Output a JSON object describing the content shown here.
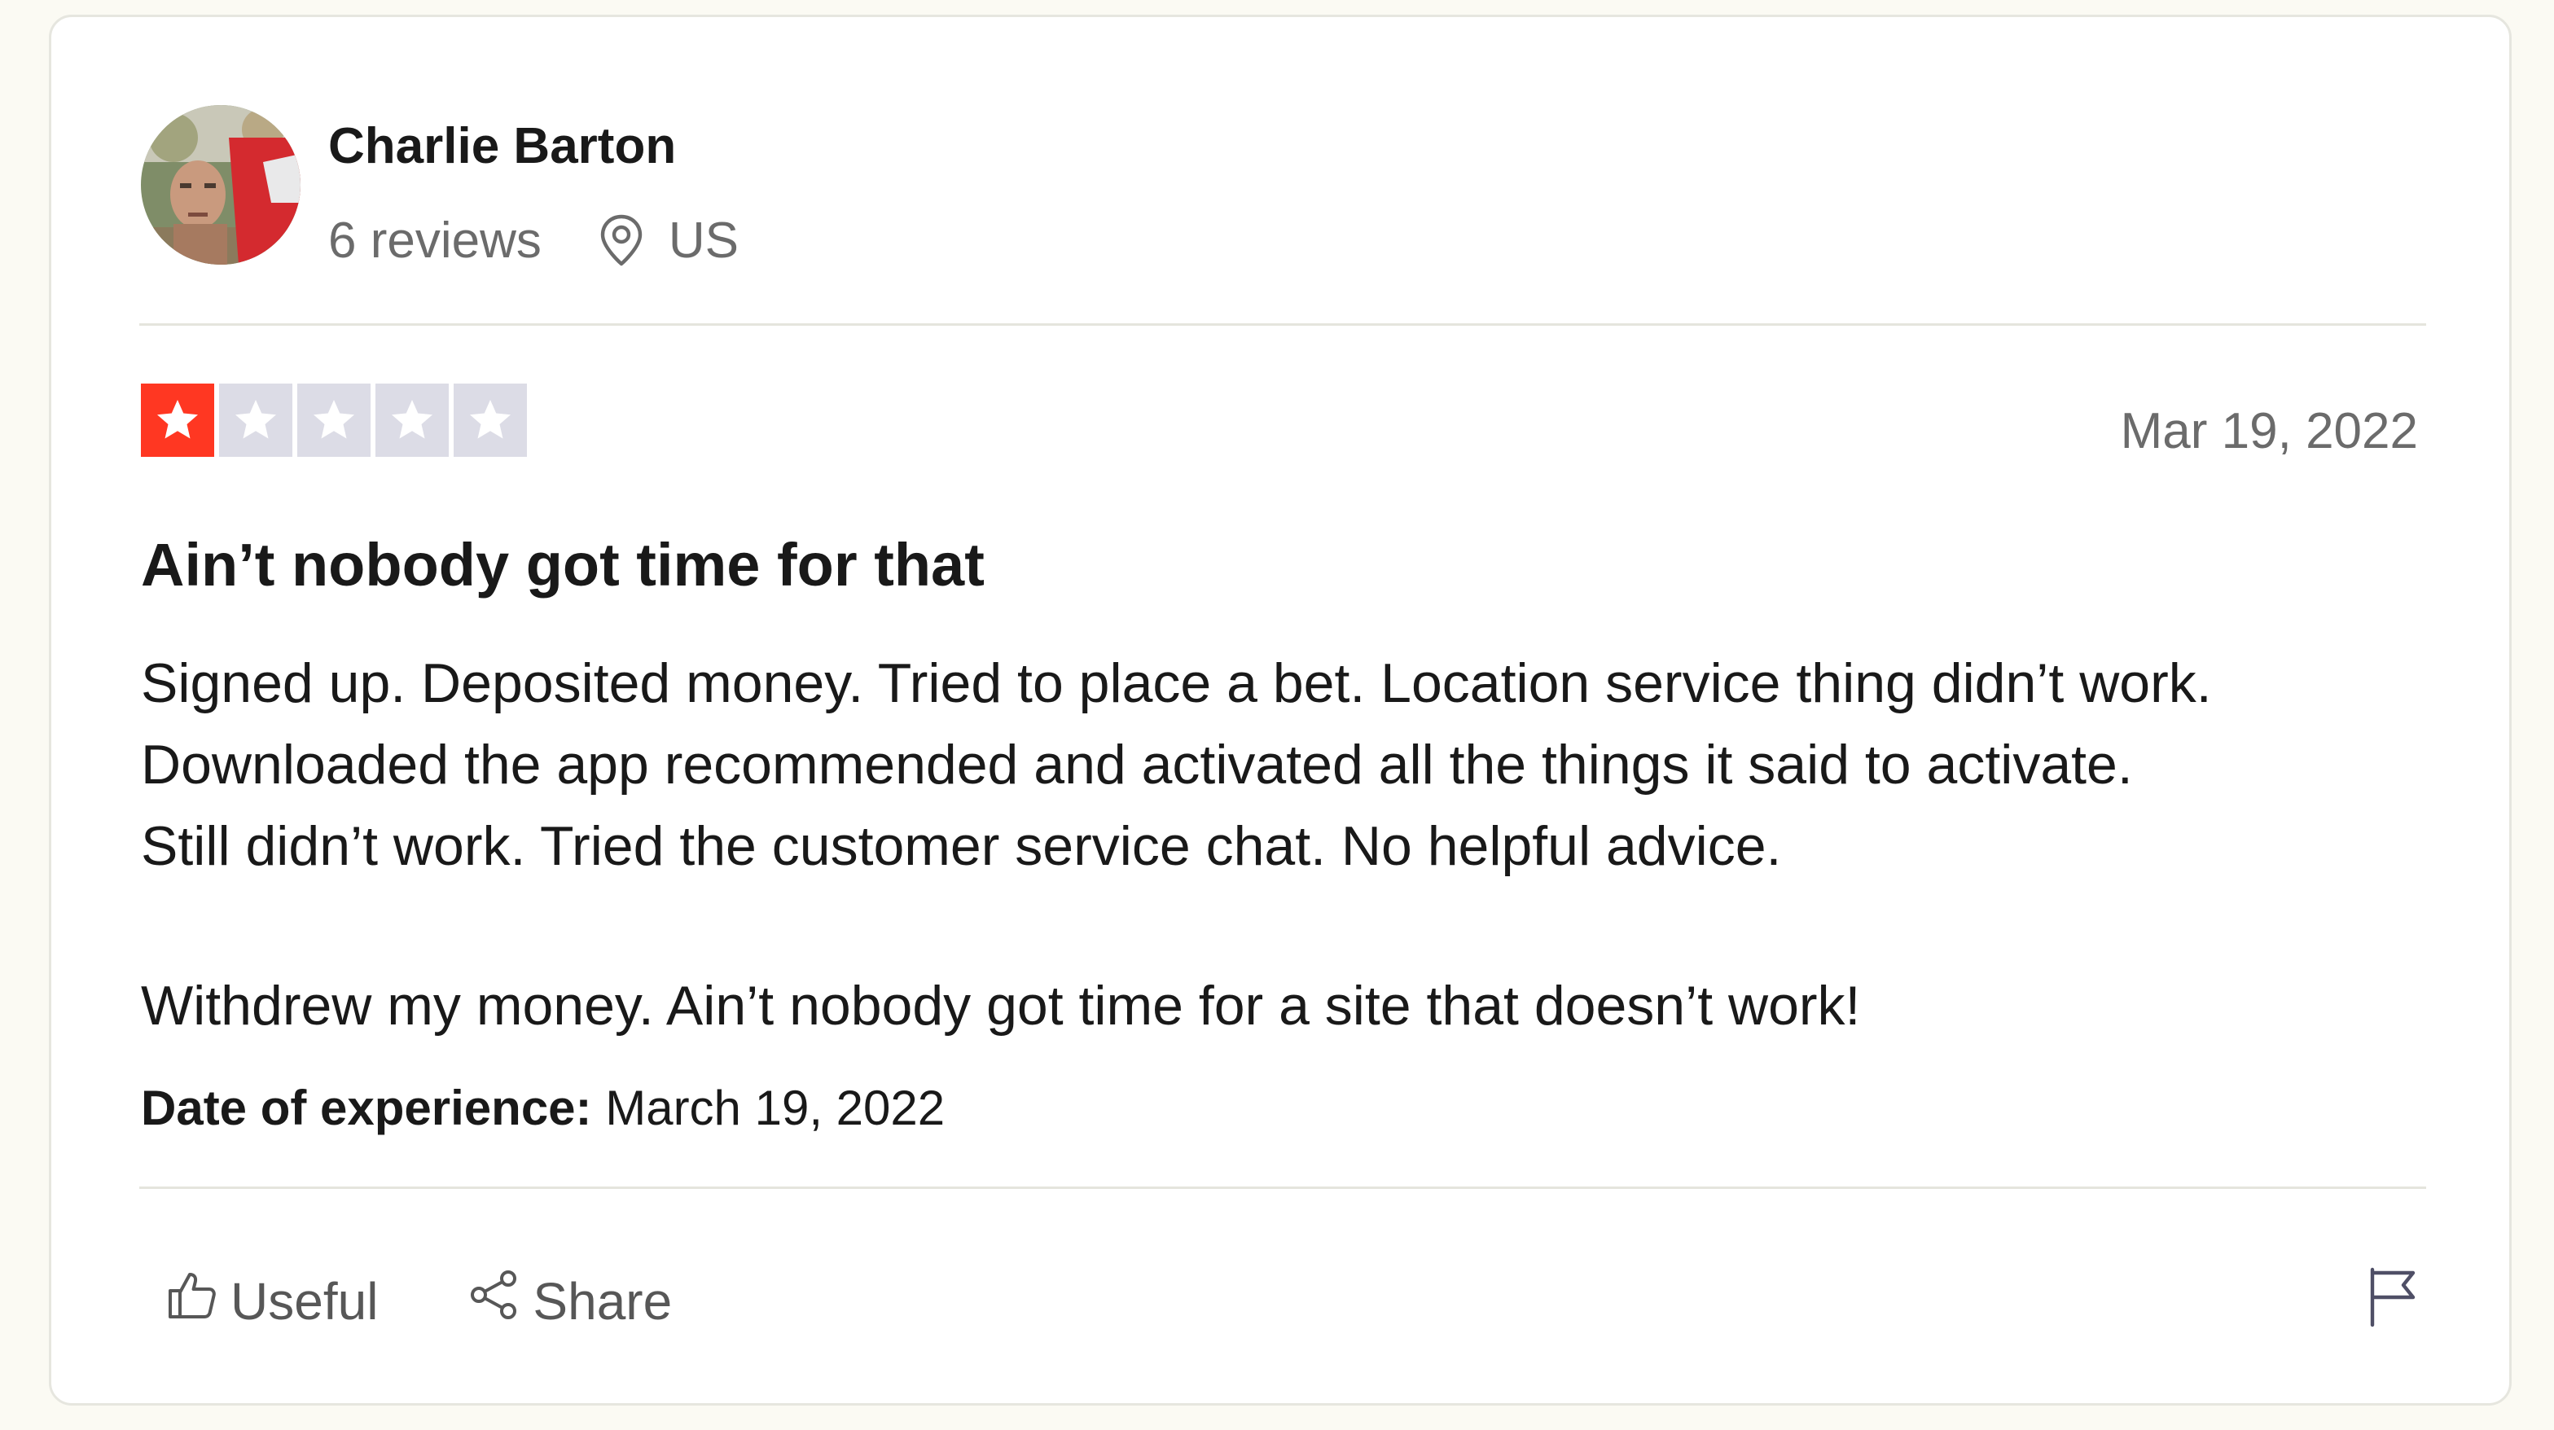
{
  "reviewer": {
    "name": "Charlie Barton",
    "reviews_count": "6 reviews",
    "location": "US"
  },
  "review": {
    "rating": 1,
    "rating_max": 5,
    "date": "Mar 19, 2022",
    "title": "Ain’t nobody got time for that",
    "body": {
      "line1": "Signed up. Deposited money. Tried to place a bet. Location service thing didn’t work.",
      "line2": "Downloaded the app recommended and activated all the things it said to activate.",
      "line3": "Still didn’t work. Tried the customer service chat. No helpful advice.",
      "line4": "Withdrew my money. Ain’t nobody got time for a site that doesn’t work!"
    },
    "experience_label": "Date of experience:",
    "experience_date": "March 19, 2022"
  },
  "actions": {
    "useful_label": "Useful",
    "share_label": "Share"
  },
  "icons": {
    "location": "location-pin-icon",
    "useful": "thumbs-up-icon",
    "share": "share-icon",
    "flag": "flag-icon",
    "star": "star-icon"
  },
  "colors": {
    "star_filled": "#ff3722",
    "star_empty": "#dcdce6",
    "page_background": "#fbfaf3",
    "card_background": "#ffffff"
  }
}
